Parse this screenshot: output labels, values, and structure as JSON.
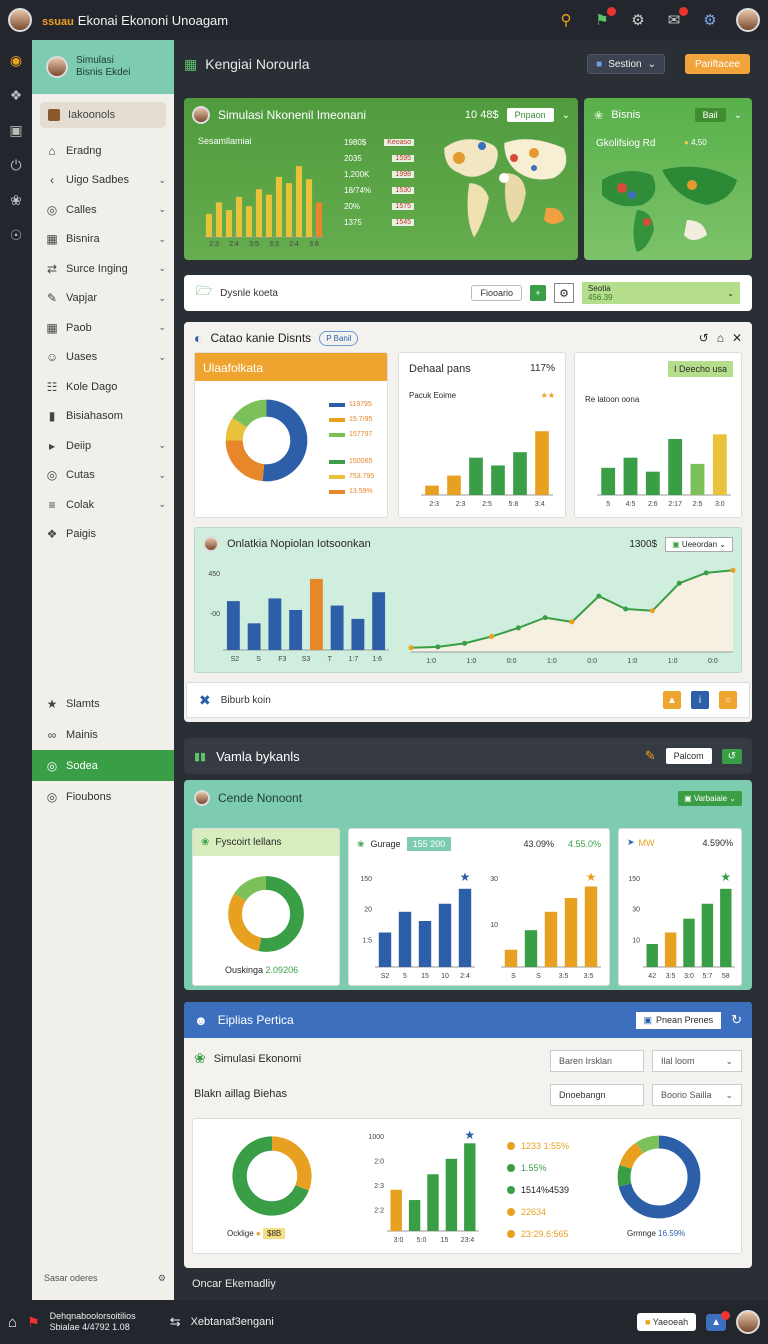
{
  "topbar": {
    "badge": "ssuau",
    "title": "Ekonai Ekononi Unoagam"
  },
  "sidebar": {
    "header_line1": "Simulasi",
    "header_line2": "Bisnis Ekdei",
    "pill": "Iakoonols",
    "items": [
      {
        "label": "Eradng",
        "icon": "home",
        "chev": false
      },
      {
        "label": "Uigo Sadbes",
        "icon": "chevron-left",
        "chev": true
      },
      {
        "label": "Calles",
        "icon": "globe",
        "chev": true
      },
      {
        "label": "Bisnira",
        "icon": "grid",
        "chev": true
      },
      {
        "label": "Surce Inging",
        "icon": "share",
        "chev": true
      },
      {
        "label": "Vapjar",
        "icon": "pencil",
        "chev": true
      },
      {
        "label": "Paob",
        "icon": "grid",
        "chev": true
      },
      {
        "label": "Uases",
        "icon": "person",
        "chev": true
      },
      {
        "label": "Kole Dago",
        "icon": "document",
        "chev": false
      },
      {
        "label": "Bisiahasom",
        "icon": "bar",
        "chev": false
      },
      {
        "label": "Deiip",
        "icon": "play",
        "chev": true
      },
      {
        "label": "Cutas",
        "icon": "target",
        "chev": true
      },
      {
        "label": "Colak",
        "icon": "chart",
        "chev": true
      },
      {
        "label": "Paigis",
        "icon": "puzzle",
        "chev": false
      }
    ],
    "lower": [
      {
        "label": "Slamts",
        "icon": "star"
      },
      {
        "label": "Mainis",
        "icon": "link"
      },
      {
        "label": "Sodea",
        "icon": "globe",
        "active": true
      },
      {
        "label": "Fioubons",
        "icon": "globe"
      }
    ],
    "foot_left": "Sasar oderes"
  },
  "header": {
    "title": "Kengiai Norourla",
    "btn1": "Sestion",
    "btn2": "Pariftacee"
  },
  "banner": {
    "title": "Simulasi Nkonenil Imeonani",
    "value": "10 48$",
    "btn": "Pnpaon",
    "chart_label": "Sesamllamiai",
    "legend": [
      {
        "a": "1980$",
        "b": "Keoaso"
      },
      {
        "a": "2035",
        "b": "1595"
      },
      {
        "a": "1,200K",
        "b": "1998"
      },
      {
        "a": "18/74%",
        "b": "1530"
      },
      {
        "a": "20%",
        "b": "1575"
      },
      {
        "a": "1375",
        "b": "1545"
      }
    ],
    "bars": [
      30,
      45,
      35,
      52,
      40,
      62,
      55,
      78,
      70,
      92,
      75,
      45
    ],
    "bars_color": [
      "#e8c23a",
      "#e8c23a",
      "#e8c23a",
      "#e8c23a",
      "#e8c23a",
      "#e8c23a",
      "#e8c23a",
      "#e8c23a",
      "#e8c23a",
      "#e8c23a",
      "#e8c23a",
      "#e8862a"
    ]
  },
  "banner2": {
    "title": "Bisnis",
    "btn": "Bail",
    "sub": "Gkolifsiog Rd",
    "val": "4,50"
  },
  "toolbar": {
    "label": "Dysnle koeta",
    "btn": "Fiooario",
    "side_title": "Seotia",
    "side_sub": "456.39"
  },
  "section1": {
    "title": "Catao kanie Disnts",
    "tag": "P Banil",
    "c1": {
      "title": "Ulaafolkata",
      "legend": [
        "119795",
        "15.7/95",
        "157797",
        "150065",
        "753.795",
        "13.59%"
      ]
    },
    "c2": {
      "title": "Dehaal pans",
      "pct": "117%",
      "sub": "Pacuk Eoime",
      "ticks": [
        "2:3",
        "2:3",
        "2:5",
        "5:8",
        "3:4"
      ]
    },
    "c3": {
      "btn": "I Deecho usa",
      "sub": "Re latoon oona",
      "ticks": [
        "5",
        "4:5",
        "2:6",
        "2:17",
        "2:5",
        "3:0"
      ]
    },
    "c4": {
      "title": "Onlatkia Nopiolan Iotsoonkan",
      "pct": "1300$",
      "btn": "Ueeordan",
      "ylabels": [
        "450",
        "-00"
      ],
      "bar_ticks": [
        "S2",
        "S",
        "F3",
        "S3",
        "T",
        "1:7",
        "1:6"
      ],
      "line_ticks": [
        "1:0",
        "1:0",
        "0:0",
        "1:0",
        "0:0",
        "1:0",
        "1:0",
        "0:0"
      ]
    },
    "foot": "Biburb koin"
  },
  "section2": {
    "title": "Vamla bykanls",
    "btn": "Palcom",
    "title2": "Cende Nonoont",
    "btn2": "Varbaiaie",
    "d1": {
      "title": "Fyscoirt lellans",
      "sub": "Ouskinga",
      "val": "2.09206"
    },
    "d2": {
      "title": "Gurage",
      "chip": "155 200",
      "pct1": "43.09%",
      "pct2": "4.55.0%",
      "y": [
        "150",
        "20",
        "1:5"
      ],
      "ticks": [
        "S2",
        "5",
        "15",
        "10",
        "2:4"
      ],
      "ticks2": [
        "S",
        "S",
        "3:5",
        "3:5"
      ]
    },
    "d3": {
      "title": "MW",
      "pct": "4.590%",
      "y": [
        "150",
        "30",
        "10"
      ],
      "ticks": [
        "42",
        "3:5",
        "3:0",
        "5:7",
        "58"
      ]
    }
  },
  "section3": {
    "title": "Eiplias Pertica",
    "btn": "Pnean Prenes",
    "sub": "Simulasi Ekonomi",
    "f1": "Baren Irsklan",
    "f2": "Ilal loom",
    "f3": "Dnoebangn",
    "f4": "Boorio Sailla",
    "label": "Blakn aillag Biehas",
    "donut1_label": "Ocklige",
    "donut1_val": "$8B",
    "y": [
      "1000",
      "2:0",
      "2:3",
      "2:2"
    ],
    "ticks": [
      "3:0",
      "5:0",
      "15",
      "23:4"
    ],
    "legend": [
      "1233 1:55%",
      "1.55%",
      "1514%4539",
      "22634",
      "23:29.6:565"
    ],
    "donut2_label": "Grmnge",
    "donut2_val": "16.59%"
  },
  "footer_text": "Oncar Ekemadliy",
  "bottombar": {
    "line1": "Dehqnaboolorsoitilios",
    "line2": "Sbialae 4/4792 1.08",
    "center": "Xebtanaf3engani",
    "btn": "Yaeoeah"
  }
}
